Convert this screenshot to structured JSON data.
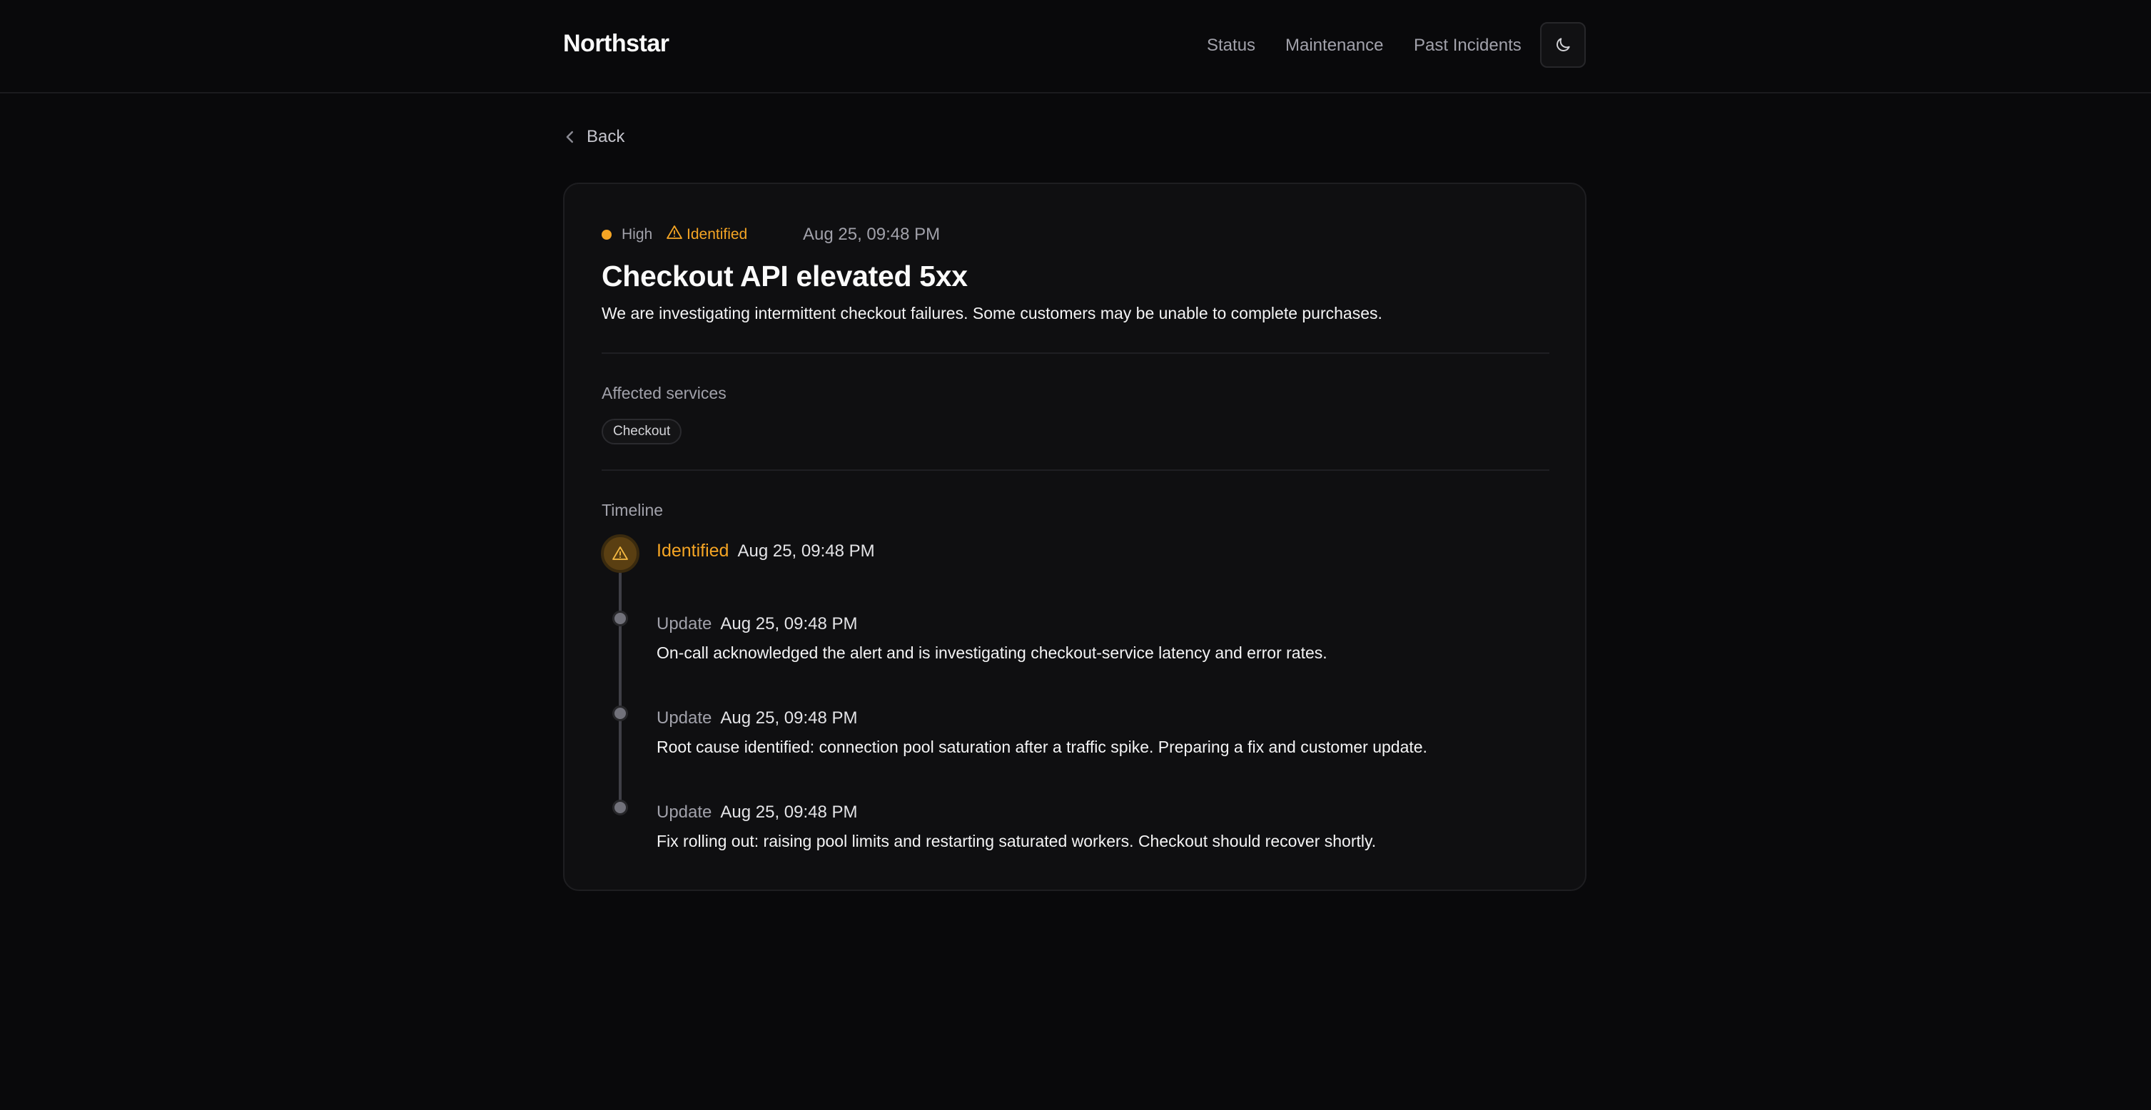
{
  "header": {
    "brand": "Northstar",
    "nav": [
      {
        "label": "Status"
      },
      {
        "label": "Maintenance"
      },
      {
        "label": "Past Incidents"
      }
    ],
    "theme_toggle_icon": "moon-icon"
  },
  "back": {
    "label": "Back",
    "icon": "chevron-left-icon"
  },
  "incident": {
    "severity": {
      "label": "High",
      "color": "#f5a524"
    },
    "status": {
      "label": "Identified",
      "icon": "warning-triangle-icon",
      "color": "#f5a524"
    },
    "time": "Aug 25, 09:48 PM",
    "title": "Checkout API elevated 5xx",
    "description": "We are investigating intermittent checkout failures. Some customers may be unable to complete purchases.",
    "affected_label": "Affected services",
    "affected_services": [
      "Checkout"
    ],
    "timeline_label": "Timeline",
    "timeline": [
      {
        "kind": "Identified",
        "time": "Aug 25, 09:48 PM",
        "body": ""
      },
      {
        "kind": "Update",
        "time": "Aug 25, 09:48 PM",
        "body": "On-call acknowledged the alert and is investigating checkout-service latency and error rates."
      },
      {
        "kind": "Update",
        "time": "Aug 25, 09:48 PM",
        "body": "Root cause identified: connection pool saturation after a traffic spike. Preparing a fix and customer update."
      },
      {
        "kind": "Update",
        "time": "Aug 25, 09:48 PM",
        "body": "Fix rolling out: raising pool limits and restarting saturated workers. Checkout should recover shortly."
      }
    ]
  },
  "colors": {
    "background": "#09090b",
    "card": "#0f0f11",
    "accent_warning": "#f5a524",
    "muted_text": "#a1a1aa"
  }
}
